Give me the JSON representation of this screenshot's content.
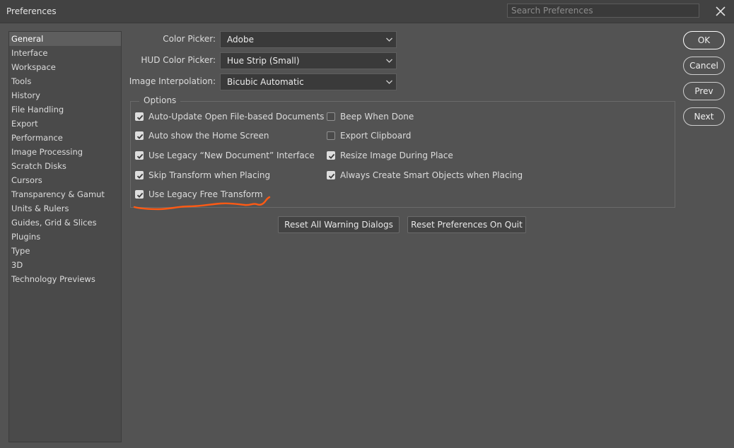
{
  "window": {
    "title": "Preferences",
    "search_placeholder": "Search Preferences"
  },
  "sidebar": {
    "items": [
      {
        "label": "General",
        "selected": true
      },
      {
        "label": "Interface"
      },
      {
        "label": "Workspace"
      },
      {
        "label": "Tools"
      },
      {
        "label": "History"
      },
      {
        "label": "File Handling"
      },
      {
        "label": "Export"
      },
      {
        "label": "Performance"
      },
      {
        "label": "Image Processing"
      },
      {
        "label": "Scratch Disks"
      },
      {
        "label": "Cursors"
      },
      {
        "label": "Transparency & Gamut"
      },
      {
        "label": "Units & Rulers"
      },
      {
        "label": "Guides, Grid & Slices"
      },
      {
        "label": "Plugins"
      },
      {
        "label": "Type"
      },
      {
        "label": "3D"
      },
      {
        "label": "Technology Previews"
      }
    ]
  },
  "fields": {
    "color_picker": {
      "label": "Color Picker:",
      "value": "Adobe"
    },
    "hud_color_picker": {
      "label": "HUD Color Picker:",
      "value": "Hue Strip (Small)"
    },
    "image_interpolation": {
      "label": "Image Interpolation:",
      "value": "Bicubic Automatic"
    }
  },
  "options": {
    "legend": "Options",
    "left": [
      {
        "label": "Auto-Update Open File-based Documents",
        "checked": true
      },
      {
        "label": "Auto show the Home Screen",
        "checked": true
      },
      {
        "label": "Use Legacy “New Document” Interface",
        "checked": true
      },
      {
        "label": "Skip Transform when Placing",
        "checked": true
      },
      {
        "label": "Use Legacy Free Transform",
        "checked": true
      }
    ],
    "right": [
      {
        "label": "Beep When Done",
        "checked": false
      },
      {
        "label": "Export Clipboard",
        "checked": false
      },
      {
        "label": "Resize Image During Place",
        "checked": true
      },
      {
        "label": "Always Create Smart Objects when Placing",
        "checked": true
      }
    ]
  },
  "buttons": {
    "reset_warnings": "Reset All Warning Dialogs",
    "reset_prefs": "Reset Preferences On Quit",
    "ok": "OK",
    "cancel": "Cancel",
    "prev": "Prev",
    "next": "Next"
  },
  "colors": {
    "annotation_stroke": "#ff5a14"
  },
  "icons": {
    "close": "close-icon",
    "dropdown": "chevron-down-icon",
    "checkbox_check": "checkmark-icon"
  }
}
